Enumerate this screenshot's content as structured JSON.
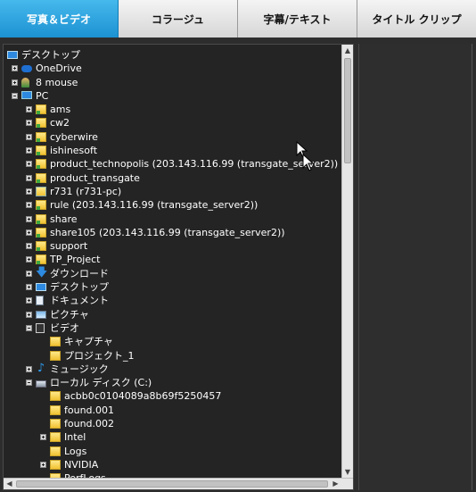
{
  "tabs": [
    {
      "label": "写真＆ビデオ",
      "active": true
    },
    {
      "label": "コラージュ",
      "active": false
    },
    {
      "label": "字幕/テキスト",
      "active": false
    },
    {
      "label": "タイトル クリップ",
      "active": false
    }
  ],
  "tree": {
    "items": [
      {
        "label": "デスクトップ",
        "icon": "desktop-icon",
        "depth": 0,
        "expander": "none"
      },
      {
        "label": "OneDrive",
        "icon": "cloud-icon",
        "depth": 1,
        "expander": "plus"
      },
      {
        "label": "8 mouse",
        "icon": "user-icon",
        "depth": 1,
        "expander": "plus"
      },
      {
        "label": "PC",
        "icon": "computer-icon",
        "depth": 1,
        "expander": "minus"
      },
      {
        "label": "ams",
        "icon": "network-folder-icon",
        "depth": 2,
        "expander": "plus"
      },
      {
        "label": "cw2",
        "icon": "network-folder-icon",
        "depth": 2,
        "expander": "plus"
      },
      {
        "label": "cyberwire",
        "icon": "network-folder-icon",
        "depth": 2,
        "expander": "plus"
      },
      {
        "label": "ishinesoft",
        "icon": "network-folder-icon",
        "depth": 2,
        "expander": "plus"
      },
      {
        "label": "product_technopolis (203.143.116.99 (transgate_server2))",
        "icon": "network-folder-icon",
        "depth": 2,
        "expander": "plus"
      },
      {
        "label": "product_transgate",
        "icon": "network-folder-icon",
        "depth": 2,
        "expander": "plus"
      },
      {
        "label": "r731 (r731-pc)",
        "icon": "network-computer-icon",
        "depth": 2,
        "expander": "plus"
      },
      {
        "label": "rule (203.143.116.99 (transgate_server2))",
        "icon": "network-folder-icon",
        "depth": 2,
        "expander": "plus"
      },
      {
        "label": "share",
        "icon": "network-folder-icon",
        "depth": 2,
        "expander": "plus"
      },
      {
        "label": "share105 (203.143.116.99 (transgate_server2))",
        "icon": "network-folder-icon",
        "depth": 2,
        "expander": "plus"
      },
      {
        "label": "support",
        "icon": "network-folder-icon",
        "depth": 2,
        "expander": "plus"
      },
      {
        "label": "TP_Project",
        "icon": "network-folder-icon",
        "depth": 2,
        "expander": "plus"
      },
      {
        "label": "ダウンロード",
        "icon": "download-icon",
        "depth": 2,
        "expander": "plus"
      },
      {
        "label": "デスクトップ",
        "icon": "desktop-icon",
        "depth": 2,
        "expander": "plus"
      },
      {
        "label": "ドキュメント",
        "icon": "document-icon",
        "depth": 2,
        "expander": "plus"
      },
      {
        "label": "ピクチャ",
        "icon": "picture-icon",
        "depth": 2,
        "expander": "plus"
      },
      {
        "label": "ビデオ",
        "icon": "video-icon",
        "depth": 2,
        "expander": "minus"
      },
      {
        "label": "キャプチャ",
        "icon": "folder-icon",
        "depth": 3,
        "expander": "none"
      },
      {
        "label": "プロジェクト_1",
        "icon": "folder-icon",
        "depth": 3,
        "expander": "none"
      },
      {
        "label": "ミュージック",
        "icon": "music-icon",
        "depth": 2,
        "expander": "plus"
      },
      {
        "label": "ローカル ディスク (C:)",
        "icon": "drive-icon",
        "depth": 2,
        "expander": "minus"
      },
      {
        "label": "acbb0c0104089a8b69f5250457",
        "icon": "folder-icon",
        "depth": 3,
        "expander": "none"
      },
      {
        "label": "found.001",
        "icon": "folder-icon",
        "depth": 3,
        "expander": "none"
      },
      {
        "label": "found.002",
        "icon": "folder-icon",
        "depth": 3,
        "expander": "none"
      },
      {
        "label": "Intel",
        "icon": "folder-icon",
        "depth": 3,
        "expander": "plus"
      },
      {
        "label": "Logs",
        "icon": "folder-icon",
        "depth": 3,
        "expander": "none"
      },
      {
        "label": "NVIDIA",
        "icon": "folder-icon",
        "depth": 3,
        "expander": "plus"
      },
      {
        "label": "PerfLogs",
        "icon": "folder-icon",
        "depth": 3,
        "expander": "none"
      }
    ]
  },
  "colors": {
    "active_tab": "#1c92d2",
    "background": "#2d2d2d",
    "tree_background": "#242424",
    "text": "#ffffff"
  }
}
